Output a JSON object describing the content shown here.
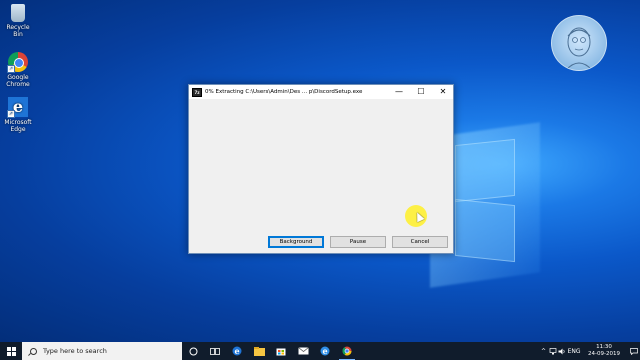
{
  "desktop": {
    "icons": [
      {
        "label": "Recycle Bin"
      },
      {
        "label": "Google Chrome"
      },
      {
        "label": "Microsoft Edge"
      }
    ]
  },
  "dialog": {
    "title": "0% Extracting C:\\Users\\Admin\\Des ... p\\DiscordSetup.exe",
    "app_icon": "7z",
    "minimize_glyph": "—",
    "maximize_glyph": "☐",
    "close_glyph": "✕",
    "buttons": {
      "background": "Background",
      "pause": "Pause",
      "cancel": "Cancel"
    }
  },
  "taskbar": {
    "search_placeholder": "Type here to search",
    "tray": {
      "language": "ENG",
      "time": "11:30",
      "date": "24-09-2019"
    }
  },
  "colors": {
    "desktop_accent": "#0b58c9",
    "taskbar": "#101c2c",
    "default_button_border": "#0078d7"
  }
}
